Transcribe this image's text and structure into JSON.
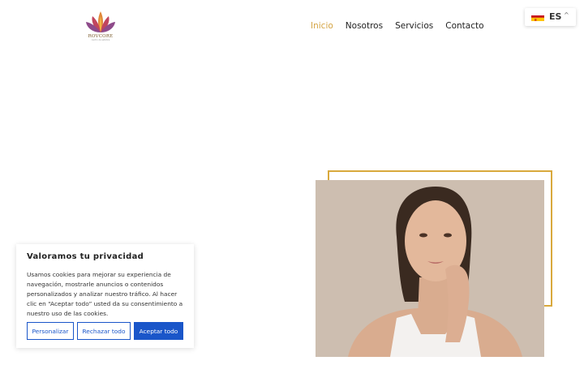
{
  "header": {
    "logo_text": "ROVCORE",
    "logo_subtext": "centro de estética"
  },
  "nav": {
    "items": [
      {
        "label": "Inicio",
        "active": true
      },
      {
        "label": "Nosotros",
        "active": false
      },
      {
        "label": "Servicios",
        "active": false
      },
      {
        "label": "Contacto",
        "active": false
      }
    ]
  },
  "language": {
    "code": "ES",
    "flag": "spain-flag-icon"
  },
  "hero": {
    "photo_icon": "woman-portrait-image",
    "frame_color": "#d9a93d"
  },
  "cookie_banner": {
    "title": "Valoramos tu privacidad",
    "body": "Usamos cookies para mejorar su experiencia de navegación, mostrarle anuncios o contenidos personalizados y analizar nuestro tráfico. Al hacer clic en “Aceptar todo” usted da su consentimiento a nuestro uso de las cookies.",
    "customize_label": "Personalizar",
    "reject_label": "Rechazar todo",
    "accept_label": "Aceptar todo",
    "accent_color": "#1a56c9"
  },
  "colors": {
    "nav_active": "#d4a443",
    "text": "#222222"
  }
}
